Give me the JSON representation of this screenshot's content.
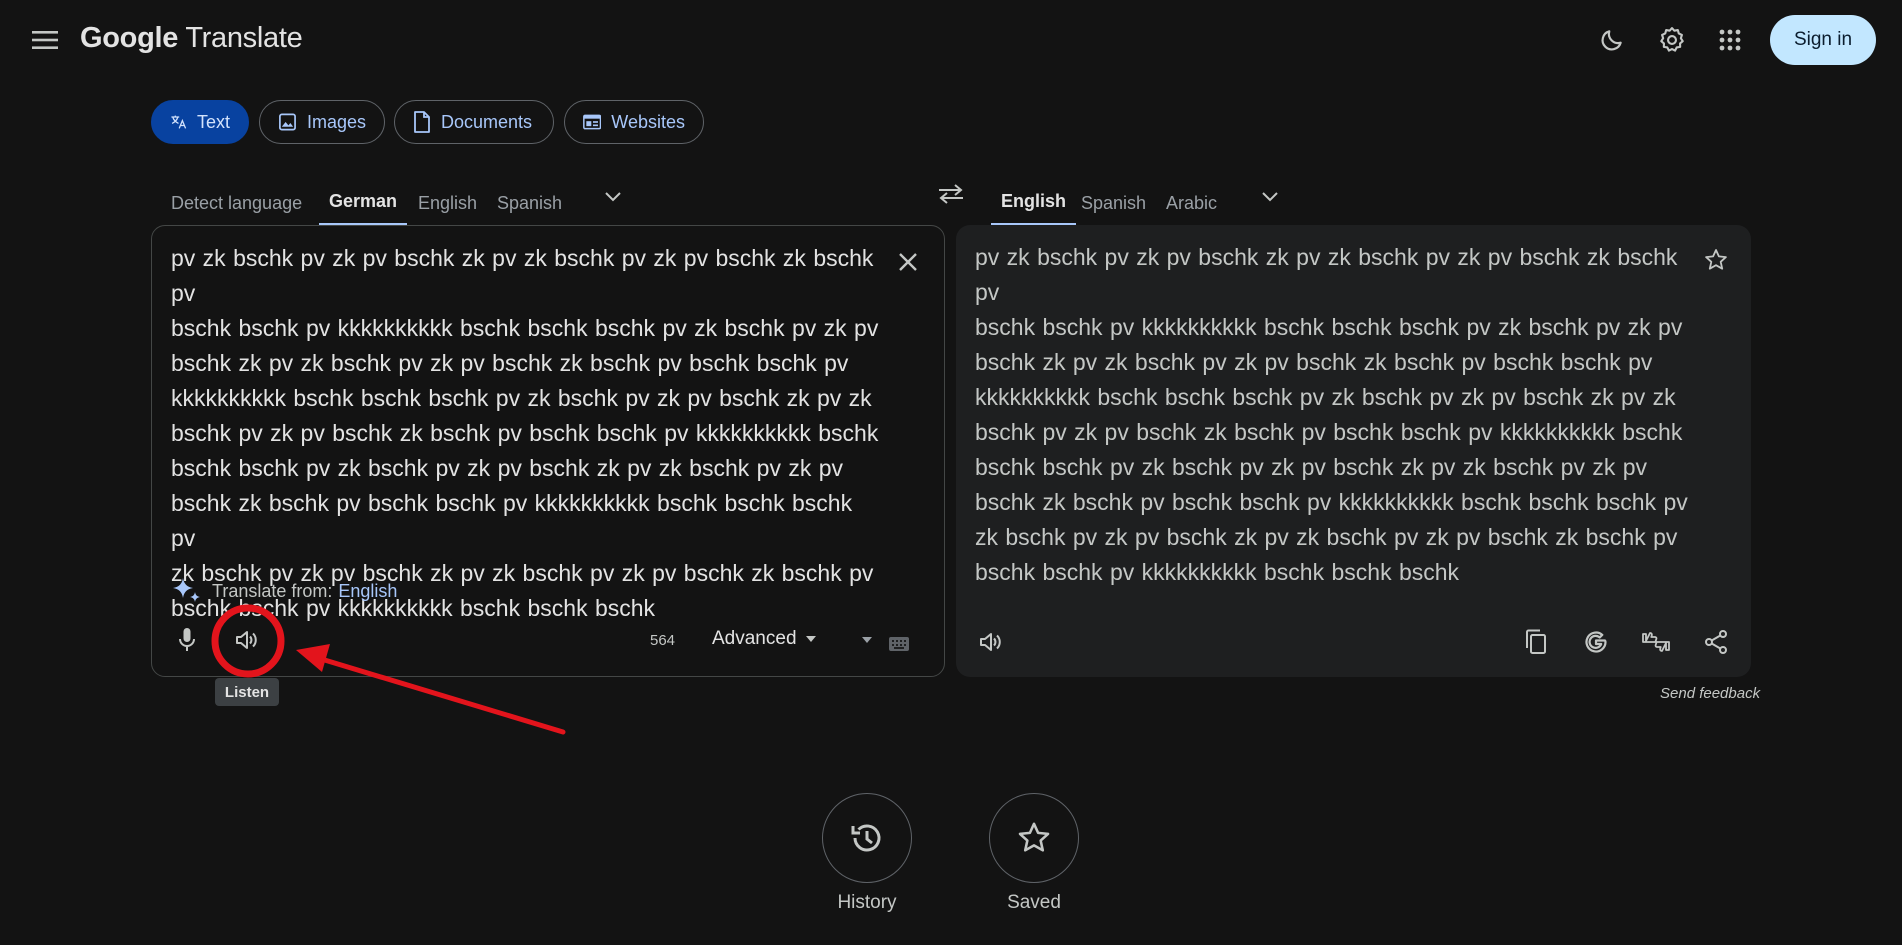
{
  "header": {
    "logo_google": "Google",
    "logo_translate": "Translate",
    "signin_label": "Sign in",
    "icons": [
      "menu-icon",
      "dark-mode-icon",
      "settings-icon",
      "apps-icon"
    ]
  },
  "modes": [
    {
      "label": "Text",
      "icon": "translate-icon",
      "active": true
    },
    {
      "label": "Images",
      "icon": "image-icon",
      "active": false
    },
    {
      "label": "Documents",
      "icon": "document-icon",
      "active": false
    },
    {
      "label": "Websites",
      "icon": "website-icon",
      "active": false
    }
  ],
  "source_langs": {
    "detect": "Detect language",
    "selected": "German",
    "opt1": "English",
    "opt2": "Spanish"
  },
  "target_langs": {
    "selected": "English",
    "opt1": "Spanish",
    "opt2": "Arabic"
  },
  "source": {
    "lines": [
      "pv zk bschk pv zk pv bschk zk pv zk bschk pv zk pv bschk zk bschk pv",
      "bschk bschk pv kkkkkkkkkk bschk bschk bschk pv zk bschk pv zk pv",
      "bschk zk pv zk bschk pv zk pv bschk zk bschk pv bschk bschk pv",
      "kkkkkkkkkk bschk bschk bschk pv zk bschk pv zk pv bschk zk pv zk",
      "bschk pv zk pv bschk zk bschk pv bschk bschk pv kkkkkkkkkk bschk",
      "bschk bschk pv zk bschk pv zk pv bschk zk pv zk bschk pv zk pv",
      "bschk zk bschk pv bschk bschk pv kkkkkkkkkk bschk bschk bschk pv",
      "zk bschk pv zk pv bschk zk pv zk bschk pv zk pv bschk zk bschk pv",
      "bschk bschk pv kkkkkkkkkk bschk bschk bschk"
    ],
    "translate_from_label": "Translate from:",
    "translate_from_lang": "English",
    "char_count": "564",
    "advanced_label": "Advanced",
    "listen_tooltip": "Listen"
  },
  "target": {
    "lines": [
      "pv zk bschk pv zk pv bschk zk pv zk bschk pv zk pv bschk zk bschk pv",
      "bschk bschk pv kkkkkkkkkk bschk bschk bschk pv zk bschk pv zk pv",
      "bschk zk pv zk bschk pv zk pv bschk zk bschk pv bschk bschk pv",
      "kkkkkkkkkk bschk bschk bschk pv zk bschk pv zk pv bschk zk pv zk",
      "bschk pv zk pv bschk zk bschk pv bschk bschk pv kkkkkkkkkk bschk",
      "bschk bschk pv zk bschk pv zk pv bschk zk pv zk bschk pv zk pv",
      "bschk zk bschk pv bschk bschk pv kkkkkkkkkk bschk bschk bschk pv",
      "zk bschk pv zk pv bschk zk pv zk bschk pv zk pv bschk zk bschk pv",
      "bschk bschk pv kkkkkkkkkk bschk bschk bschk"
    ],
    "send_feedback": "Send feedback"
  },
  "bottom": {
    "history_label": "History",
    "saved_label": "Saved"
  },
  "colors": {
    "background": "#131313",
    "accent": "#a8c7fa",
    "active_tab": "#0842a0",
    "annotation": "#e3141c"
  }
}
